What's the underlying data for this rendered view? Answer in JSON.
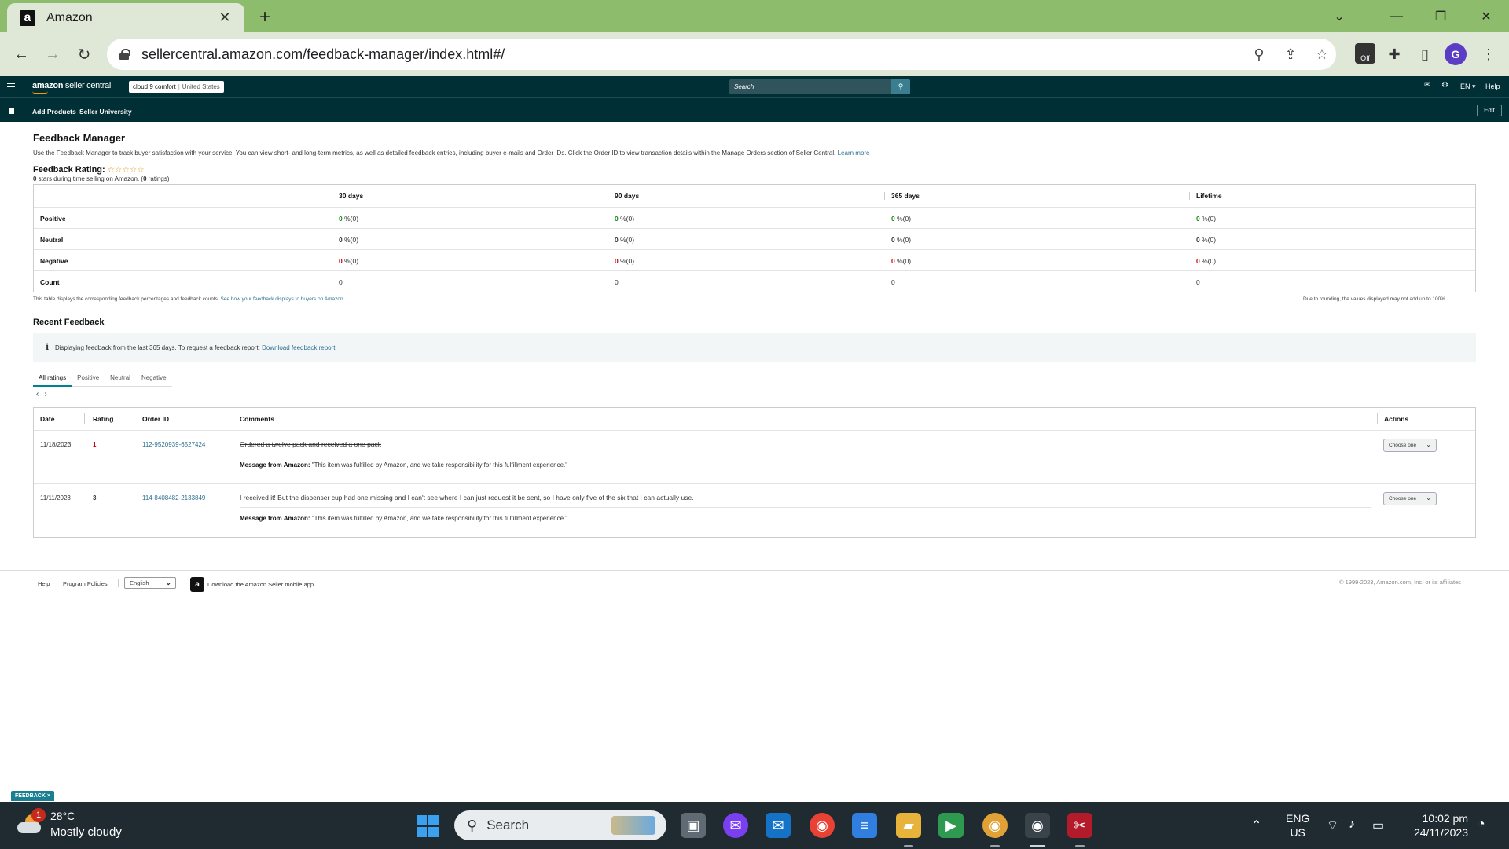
{
  "browser": {
    "tab_title": "Amazon",
    "url": "sellercentral.amazon.com/feedback-manager/index.html#/",
    "extension_badge": "Off",
    "profile_initial": "G"
  },
  "seller_header": {
    "logo_text_bold": "amazon",
    "logo_text": " seller central",
    "store_name": "cloud 9 comfort",
    "store_country": "United States",
    "search_placeholder": "Search",
    "language": "EN",
    "help": "Help"
  },
  "subnav": {
    "links": [
      "Add Products",
      "Seller University"
    ],
    "edit": "Edit"
  },
  "page": {
    "title": "Feedback Manager",
    "description": "Use the Feedback Manager to track buyer satisfaction with your service. You can view short- and long-term metrics, as well as detailed feedback entries, including buyer e-mails and Order IDs. Click the Order ID to view transaction details within the Manage Orders section of Seller Central.",
    "learn_more": "Learn more",
    "rating_label": "Feedback Rating:",
    "stars": "☆☆☆☆☆",
    "rating_sub_count": "0",
    "rating_sub_text": " stars during time selling on Amazon. (",
    "rating_sub_ratings": "0",
    "rating_sub_suffix": " ratings)"
  },
  "metrics": {
    "columns": [
      "30 days",
      "90 days",
      "365 days",
      "Lifetime"
    ],
    "rows": [
      {
        "label": "Positive",
        "values": [
          "0",
          "0",
          "0",
          "0"
        ],
        "suffix": " %(0)"
      },
      {
        "label": "Neutral",
        "values": [
          "0",
          "0",
          "0",
          "0"
        ],
        "suffix": " %(0)"
      },
      {
        "label": "Negative",
        "values": [
          "0",
          "0",
          "0",
          "0"
        ],
        "suffix": " %(0)"
      },
      {
        "label": "Count",
        "values": [
          "0",
          "0",
          "0",
          "0"
        ],
        "suffix": ""
      }
    ],
    "note_left": "This table displays the corresponding feedback percentages and feedback counts.",
    "note_left_link": "See how your feedback displays to buyers on Amazon.",
    "note_right": "Due to rounding, the values displayed may not add up to 100%."
  },
  "recent": {
    "title": "Recent Feedback",
    "info_text": "Displaying feedback from the last 365 days. To request a feedback report:",
    "info_link": "Download feedback report",
    "tabs": [
      "All ratings",
      "Positive",
      "Neutral",
      "Negative"
    ],
    "pager_prev": "‹",
    "pager_next": "›",
    "columns": {
      "date": "Date",
      "rating": "Rating",
      "order_id": "Order ID",
      "comments": "Comments",
      "actions": "Actions"
    },
    "rows": [
      {
        "date": "11/18/2023",
        "rating": "1",
        "order_id": "112-9520939-6527424",
        "comment": "Ordered a twelve pack and received a one pack",
        "msg_label": "Message from Amazon:",
        "msg_text": " \"This item was fulfilled by Amazon, and we take responsibility for this fulfillment experience.\"",
        "action": "Choose one"
      },
      {
        "date": "11/11/2023",
        "rating": "3",
        "order_id": "114-8408482-2133849",
        "comment": "I received it! But the dispenser cup had one missing and I can't see where I can just request it be sent, so I have only five of the six that I can actually use.",
        "msg_label": "Message from Amazon:",
        "msg_text": " \"This item was fulfilled by Amazon, and we take responsibility for this fulfillment experience.\"",
        "action": "Choose one"
      }
    ]
  },
  "footer": {
    "help": "Help",
    "policies": "Program Policies",
    "language": "English",
    "app_text": "Download the Amazon Seller mobile app",
    "copyright": "© 1999-2023, Amazon.com, Inc. or its affiliates",
    "feedback_tag": "FEEDBACK ×"
  },
  "taskbar": {
    "weather_badge": "1",
    "temperature": "28°C",
    "weather": "Mostly cloudy",
    "search": "Search",
    "lang_line1": "ENG",
    "lang_line2": "US",
    "time": "10:02 pm",
    "date": "24/11/2023"
  },
  "colors": {
    "tabbar": "#8cbc6c",
    "seller_header": "#002f36",
    "positive": "#138a13",
    "negative": "#c40000",
    "link": "#2a6f8f",
    "accent": "#008296"
  }
}
